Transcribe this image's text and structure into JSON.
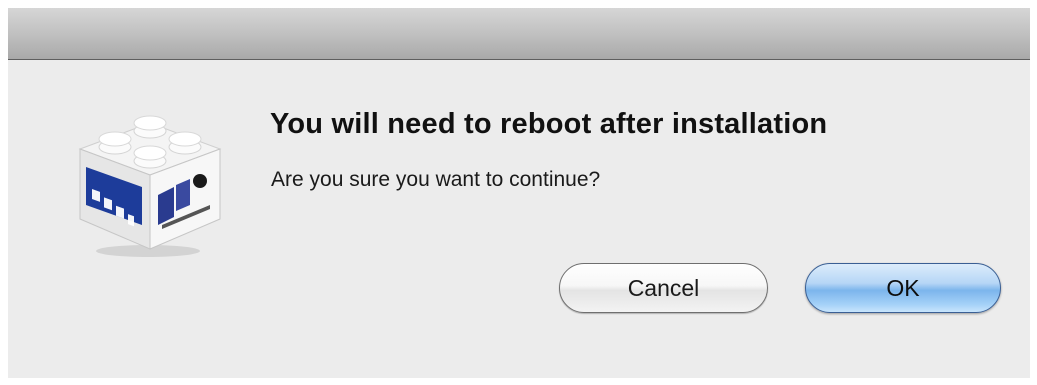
{
  "dialog": {
    "title": "You will need to reboot after installation",
    "message": "Are you sure you want to continue?",
    "icon": "installer-package-icon",
    "buttons": {
      "cancel_label": "Cancel",
      "ok_label": "OK"
    },
    "colors": {
      "background": "#ececec",
      "default_button": "#7cb5ec"
    }
  }
}
